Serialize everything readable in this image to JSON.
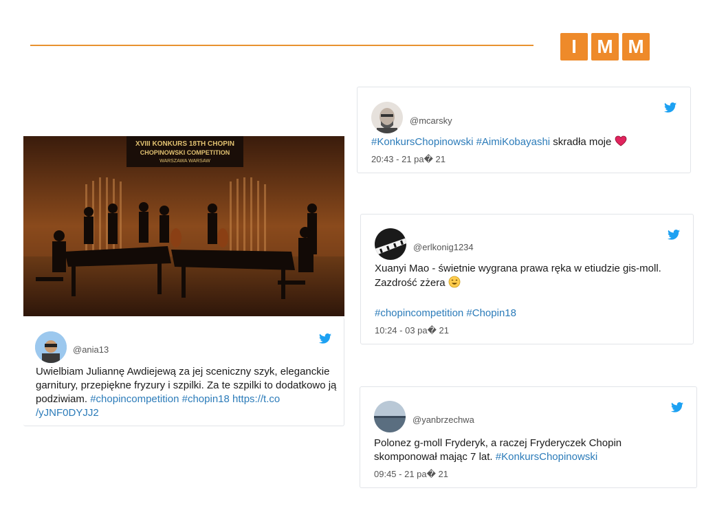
{
  "logo": {
    "letters": [
      "I",
      "M",
      "M"
    ],
    "color": "#ee8a2a"
  },
  "photo": {
    "banner_line1": "XVIII KONKURS 18TH CHOPIN",
    "banner_line2": "CHOPINOWSKI COMPETITION",
    "banner_line3": "WARSZAWA WARSAW"
  },
  "tweets": [
    {
      "handle": "@ania13",
      "text": "Uwielbiam Juliannę Awdiejewą za jej sceniczny szyk, eleganckie garnitury, przepiękne fryzury i szpilki. Za te szpilki to dodatkowo ją podziwiam. ",
      "tags": "#chopincompetition #chopin18 https://t.co/yJNF0DYJJ2",
      "tags_line1": "#chopincompetition #chopin18 https://t.co",
      "tags_line2": "/yJNF0DYJJ2"
    },
    {
      "handle": "@mcarsky",
      "tags": "#KonkursChopinowski #AimiKobayashi",
      "text": " skradła moje ",
      "emoji": "heart-icon",
      "time": "20:43 - 21 pa� 21"
    },
    {
      "handle": "@erlkonig1234",
      "text_line1": "Xuanyi Mao - świetnie wygrana prawa ręka w etiudzie gis-moll.",
      "text_line2": "Zazdrość zżera ",
      "emoji": "grin-emoji-icon",
      "tags": "#chopincompetition #Chopin18",
      "time": "10:24 - 03 pa� 21"
    },
    {
      "handle": "@yanbrzechwa",
      "text_line1": "Polonez g-moll Fryderyk, a raczej Fryderyczek Chopin",
      "text_line2": "skomponował mając 7 lat. ",
      "tags": "#KonkursChopinowski",
      "time": "09:45 - 21 pa� 21"
    }
  ],
  "colors": {
    "accent_line": "#e8912e",
    "link": "#2b7bb9",
    "twitter": "#1da1f2"
  }
}
